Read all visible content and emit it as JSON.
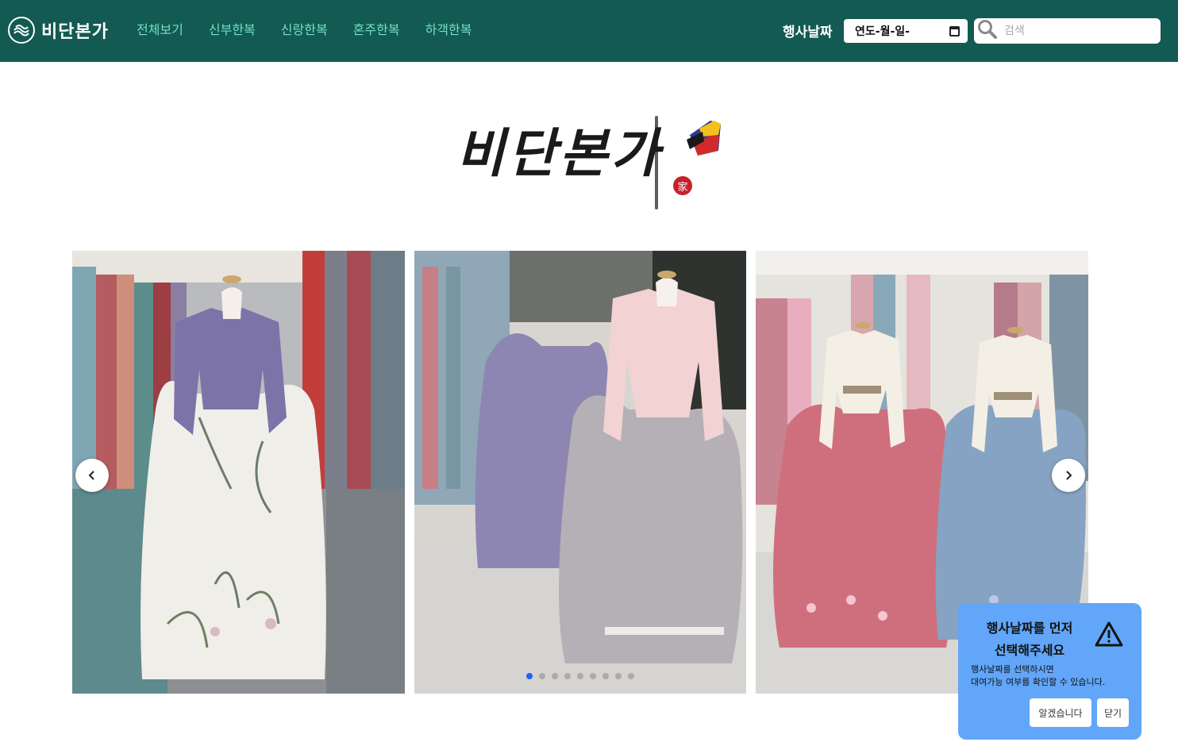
{
  "header": {
    "brand": "비단본가",
    "nav": [
      "전체보기",
      "신부한복",
      "신랑한복",
      "혼주한복",
      "하객한복"
    ],
    "event_date_label": "행사날짜",
    "date_input_text": "연도-월-일-",
    "search_placeholder": "검색"
  },
  "hero": {
    "logo_text": "비단본가",
    "seal_char": "家"
  },
  "carousel": {
    "slide_count": 9,
    "active_index": 0
  },
  "toast": {
    "title_line1": "행사날짜를 먼저",
    "title_line2": "선택해주세요",
    "body_line1": "행사날짜를 선택하시면",
    "body_line2": "대여가능 여부를 확인할 수 있습니다.",
    "confirm_label": "알겠습니다",
    "close_label": "닫기"
  },
  "colors": {
    "header_bg": "#135a52",
    "nav_link": "#72e0c8",
    "toast_bg": "#61a6f8",
    "dot_active": "#1e62ff"
  }
}
